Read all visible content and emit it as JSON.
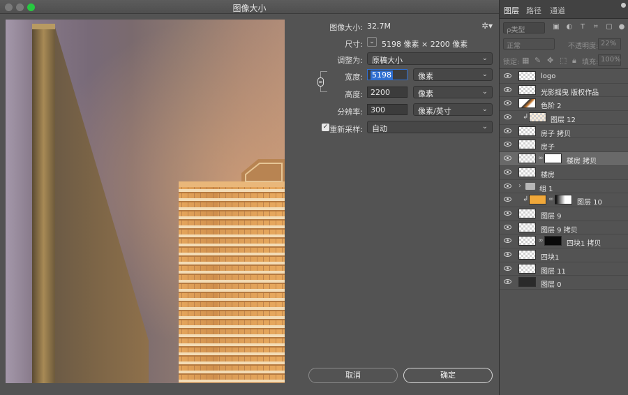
{
  "dialog": {
    "title": "图像大小",
    "image_size_label": "图像大小:",
    "image_size_value": "32.7M",
    "dimensions_label": "尺寸:",
    "dimensions_value": "5198 像素  ×  2200 像素",
    "fit_to_label": "调整为:",
    "fit_to_value": "原稿大小",
    "width_label": "宽度:",
    "width_value": "5198",
    "width_unit": "像素",
    "height_label": "高度:",
    "height_value": "2200",
    "height_unit": "像素",
    "resolution_label": "分辨率:",
    "resolution_value": "300",
    "resolution_unit": "像素/英寸",
    "resample_label": "重新采样:",
    "resample_value": "自动",
    "resample_checked": true,
    "cancel_label": "取消",
    "ok_label": "确定"
  },
  "panel": {
    "tabs": [
      "图层",
      "路径",
      "通道"
    ],
    "active_tab": "图层",
    "filter_placeholder": "ρ类型",
    "blend_mode": "正常",
    "opacity_label": "不透明度:",
    "opacity_value": "22%",
    "lock_label": "锁定:",
    "fill_label": "填充:",
    "fill_value": "100%",
    "layers": [
      {
        "name": "logo"
      },
      {
        "name": "光影摇曳 版权作品"
      },
      {
        "name": "色阶 2"
      },
      {
        "name": "图层 12"
      },
      {
        "name": "房子 拷贝"
      },
      {
        "name": "房子"
      },
      {
        "name": "楼房 拷贝"
      },
      {
        "name": "楼房"
      },
      {
        "name": "组 1"
      },
      {
        "name": "图层 10"
      },
      {
        "name": "图层 9"
      },
      {
        "name": "图层 9 拷贝"
      },
      {
        "name": "四块1 拷贝"
      },
      {
        "name": "四块1"
      },
      {
        "name": "图层 11"
      },
      {
        "name": "图层 0"
      }
    ]
  }
}
